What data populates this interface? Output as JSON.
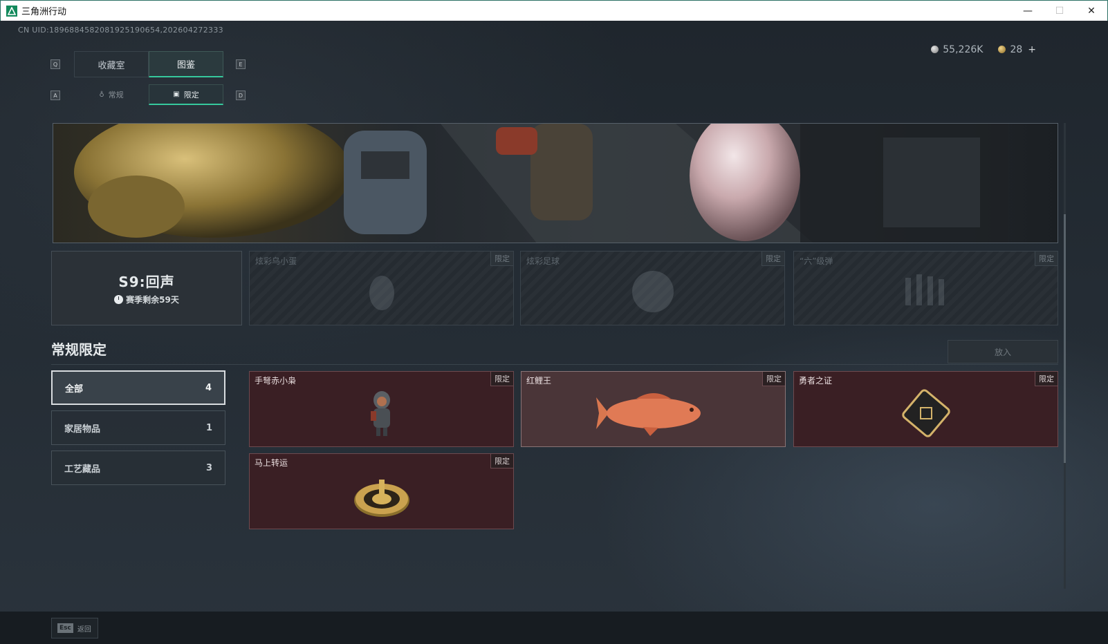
{
  "window": {
    "title": "三角洲行动",
    "min": "—",
    "max": "☐",
    "close": "✕"
  },
  "uid": "CN UID:18968845820819251906​54,202604272333",
  "currency": {
    "silver": "55,226K",
    "gold": "28",
    "plus": "+"
  },
  "keys": {
    "q": "Q",
    "e": "E",
    "a": "A",
    "d": "D"
  },
  "tabs": [
    {
      "label": "收藏室"
    },
    {
      "label": "图鉴"
    }
  ],
  "subtabs": [
    {
      "label": "常规"
    },
    {
      "label": "限定"
    }
  ],
  "season": {
    "title": "S9:回声",
    "remaining": "赛季剩余59天"
  },
  "season_slots": [
    {
      "name": "炫彩乌小蛋",
      "badge": "限定"
    },
    {
      "name": "炫彩足球",
      "badge": "限定"
    },
    {
      "name": "“六”级弹",
      "badge": "限定"
    }
  ],
  "section": {
    "title": "常规限定",
    "put_button": "放入"
  },
  "categories": [
    {
      "label": "全部",
      "count": "4"
    },
    {
      "label": "家居物品",
      "count": "1"
    },
    {
      "label": "工艺藏品",
      "count": "3"
    }
  ],
  "items": [
    {
      "name": "手弩赤小枭",
      "badge": "限定"
    },
    {
      "name": "红鲤王",
      "badge": "限定"
    },
    {
      "name": "勇者之证",
      "badge": "限定"
    },
    {
      "name": "马上转运",
      "badge": "限定"
    }
  ],
  "bottom": {
    "esc_key": "Esc",
    "esc_label": "返回"
  },
  "colors": {
    "accent": "#36c99d",
    "item_bg": "#3a1f24"
  }
}
